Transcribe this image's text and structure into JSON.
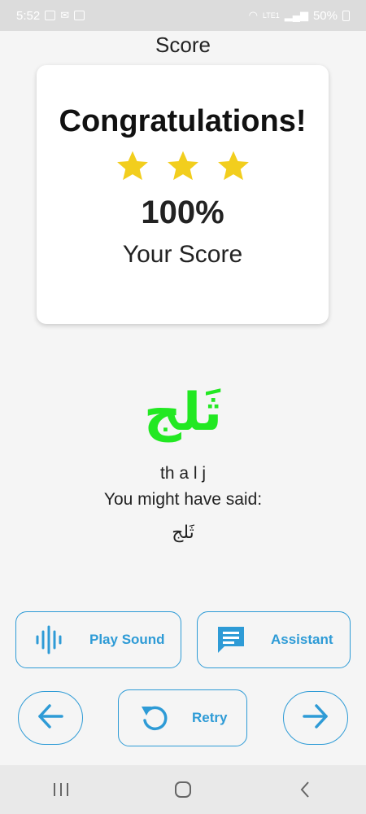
{
  "status_bar": {
    "time": "5:52",
    "battery": "50%",
    "network": "LTE1"
  },
  "page_title": "Score",
  "score_card": {
    "headline": "Congratulations!",
    "stars_earned": 3,
    "stars_total": 3,
    "star_color": "#F2CE1D",
    "score": "100%",
    "score_label": "Your Score"
  },
  "word": {
    "arabic": "ثَلج",
    "arabic_color": "#22E822",
    "transliteration": "th a l j",
    "said_label": "You might have said:",
    "said_word": "ثَلج"
  },
  "buttons": {
    "play_sound": "Play Sound",
    "assistant": "Assistant",
    "retry": "Retry",
    "accent_color": "#2E9BD6"
  },
  "icons": {
    "play_sound": "waveform-icon",
    "assistant": "chat-bubble-icon",
    "retry": "refresh-icon",
    "prev": "arrow-left-icon",
    "next": "arrow-right-icon"
  }
}
